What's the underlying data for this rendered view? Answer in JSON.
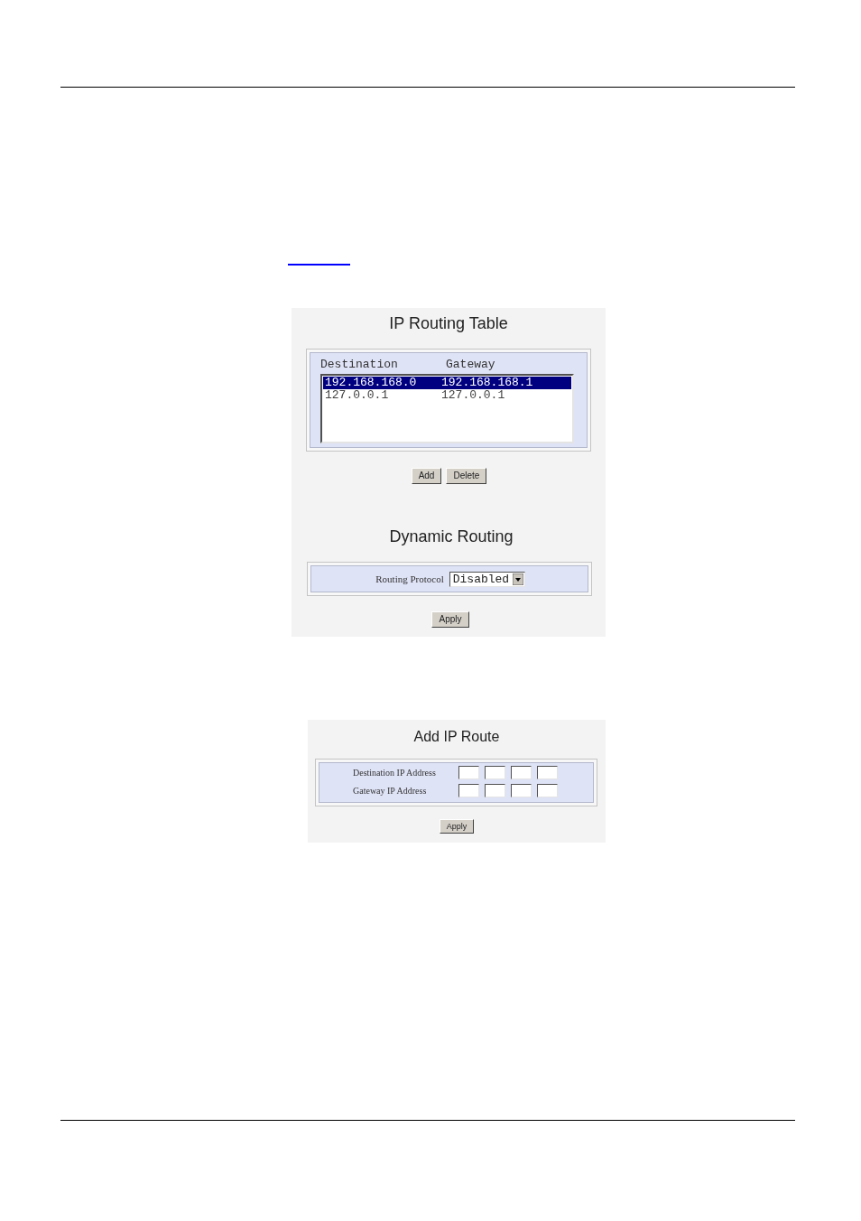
{
  "routing_table": {
    "title": "IP Routing Table",
    "columns": [
      "Destination",
      "Gateway"
    ],
    "rows": [
      {
        "cells": [
          "192.168.168.0",
          "192.168.168.1"
        ],
        "selected": true
      },
      {
        "cells": [
          "127.0.0.1",
          "127.0.0.1"
        ],
        "selected": false
      }
    ],
    "buttons": [
      "Add",
      "Delete"
    ]
  },
  "dynamic_routing": {
    "title": "Dynamic Routing",
    "field": {
      "label": "Routing Protocol",
      "value": "Disabled"
    },
    "buttons": [
      "Apply"
    ]
  },
  "add_ip_route": {
    "title": "Add IP Route",
    "fields": [
      {
        "label": "Destination IP Address"
      },
      {
        "label": "Gateway IP Address"
      }
    ],
    "buttons": [
      "Apply"
    ]
  }
}
